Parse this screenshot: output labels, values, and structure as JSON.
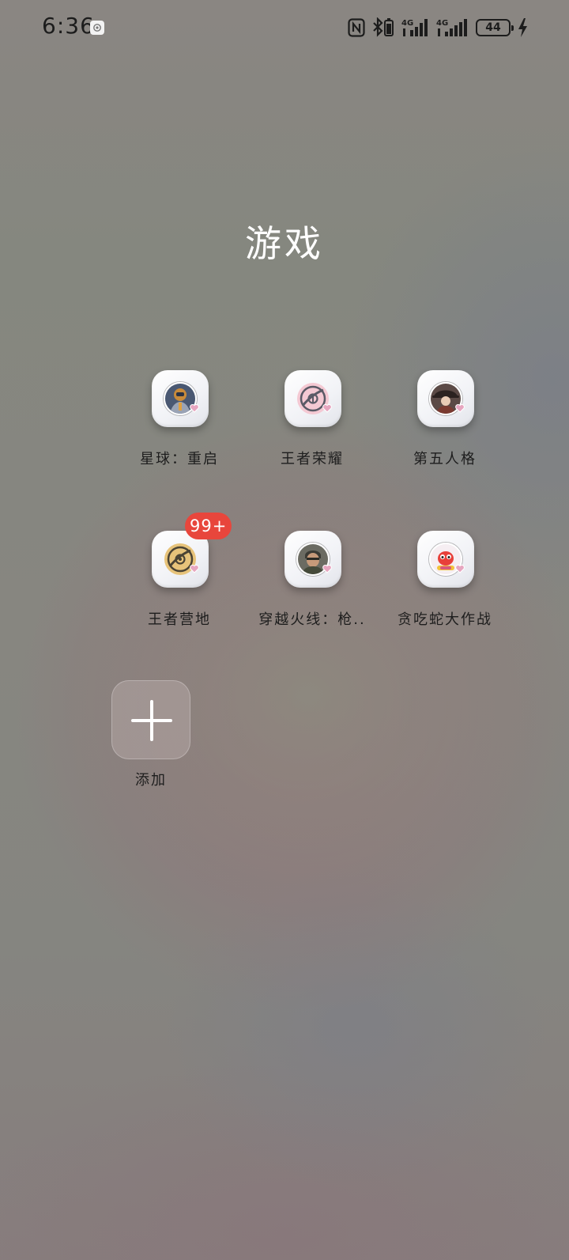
{
  "status_bar": {
    "time": "6:36",
    "network_1": "4G",
    "network_2": "4G",
    "battery": "44"
  },
  "folder": {
    "title": "游戏",
    "apps": [
      {
        "label": "星球：重启",
        "icon": "sci-fi-soldier-icon",
        "badge": ""
      },
      {
        "label": "王者荣耀",
        "icon": "honor-of-kings-icon",
        "badge": ""
      },
      {
        "label": "第五人格",
        "icon": "identity-v-icon",
        "badge": ""
      },
      {
        "label": "王者营地",
        "icon": "king-camp-icon",
        "badge": "99+"
      },
      {
        "label": "穿越火线：枪..",
        "icon": "crossfire-soldier-icon",
        "badge": ""
      },
      {
        "label": "贪吃蛇大作战",
        "icon": "snake-game-icon",
        "badge": ""
      }
    ],
    "add_label": "添加"
  },
  "colors": {
    "badge": "#e8463c",
    "title": "#ffffff",
    "label": "#1d1d1d"
  }
}
